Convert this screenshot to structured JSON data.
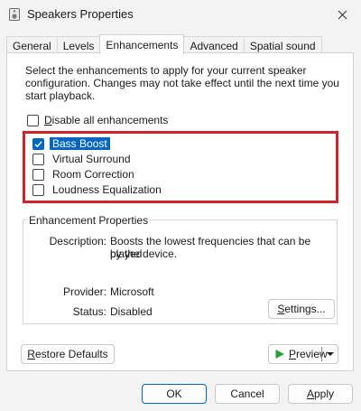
{
  "window": {
    "title": "Speakers Properties"
  },
  "tabs": [
    {
      "label": "General"
    },
    {
      "label": "Levels"
    },
    {
      "label": "Enhancements"
    },
    {
      "label": "Advanced"
    },
    {
      "label": "Spatial sound"
    }
  ],
  "panel": {
    "description": "Select the enhancements to apply for your current speaker configuration. Changes may not take effect until the next time you start playback.",
    "disable_all": {
      "prefix": "",
      "underline": "D",
      "rest": "isable all enhancements",
      "checked": false
    },
    "enhancements": [
      {
        "label": "Bass Boost",
        "checked": true,
        "selected": true
      },
      {
        "label": "Virtual Surround",
        "checked": false,
        "selected": false
      },
      {
        "label": "Room Correction",
        "checked": false,
        "selected": false
      },
      {
        "label": "Loudness Equalization",
        "checked": false,
        "selected": false
      }
    ],
    "properties": {
      "legend": "Enhancement Properties",
      "description_label": "Description:",
      "description_value_line1": "Boosts the lowest frequencies that can be played",
      "description_value_line2": "by the device.",
      "provider_label": "Provider:",
      "provider_value": "Microsoft",
      "status_label": "Status:",
      "status_value": "Disabled",
      "settings_button": {
        "underline": "S",
        "rest": "ettings..."
      }
    },
    "restore_defaults": {
      "prefix": "",
      "underline": "R",
      "rest": "estore Defaults"
    },
    "preview": {
      "prefix": "",
      "underline": "P",
      "rest": "review"
    }
  },
  "footer": {
    "ok": "OK",
    "cancel": "Cancel",
    "apply": {
      "underline": "A",
      "rest": "pply"
    }
  },
  "colors": {
    "accent": "#0067c0",
    "highlight_border": "#d2232a",
    "preview_icon": "#2e9e3a"
  }
}
